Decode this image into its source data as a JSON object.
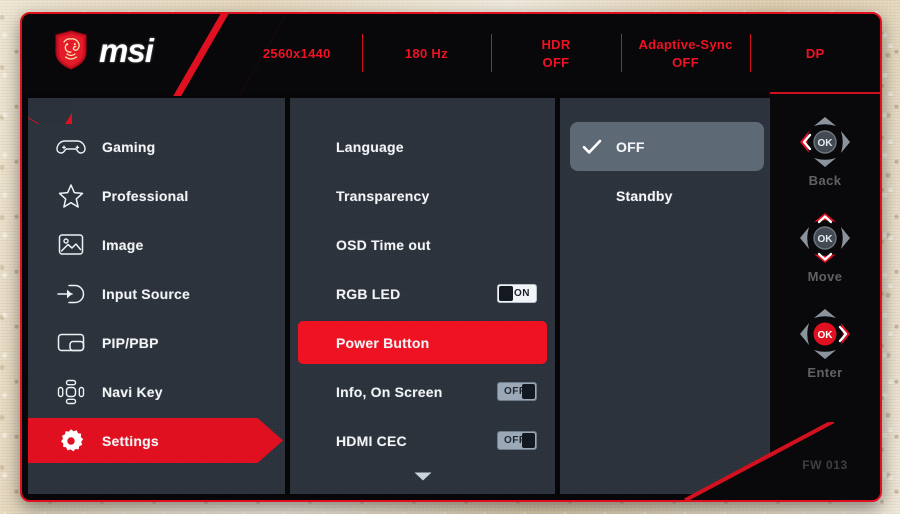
{
  "header": {
    "logo_icon": "msi-dragon-shield-icon",
    "brand": "msi",
    "info": [
      {
        "label": "2560x1440",
        "value": ""
      },
      {
        "label": "180 Hz",
        "value": ""
      },
      {
        "label": "HDR",
        "value": "OFF"
      },
      {
        "label": "Adaptive-Sync",
        "value": "OFF"
      },
      {
        "label": "DP",
        "value": ""
      }
    ]
  },
  "sidebar": {
    "items": [
      {
        "label": "Gaming",
        "icon": "gamepad-icon",
        "active": false
      },
      {
        "label": "Professional",
        "icon": "star-icon",
        "active": false
      },
      {
        "label": "Image",
        "icon": "picture-icon",
        "active": false
      },
      {
        "label": "Input Source",
        "icon": "input-arrow-icon",
        "active": false
      },
      {
        "label": "PIP/PBP",
        "icon": "pip-pbp-icon",
        "active": false
      },
      {
        "label": "Navi Key",
        "icon": "navi-key-icon",
        "active": false
      },
      {
        "label": "Settings",
        "icon": "gear-icon",
        "active": true
      }
    ]
  },
  "menu": {
    "items": [
      {
        "label": "Language",
        "toggle": null,
        "selected": false
      },
      {
        "label": "Transparency",
        "toggle": null,
        "selected": false
      },
      {
        "label": "OSD Time out",
        "toggle": null,
        "selected": false
      },
      {
        "label": "RGB LED",
        "toggle": "ON",
        "selected": false
      },
      {
        "label": "Power Button",
        "toggle": null,
        "selected": true
      },
      {
        "label": "Info, On Screen",
        "toggle": "OFF",
        "selected": false
      },
      {
        "label": "HDMI CEC",
        "toggle": "OFF",
        "selected": false
      }
    ],
    "scroll_down_icon": "chevron-down-icon"
  },
  "options": {
    "items": [
      {
        "label": "OFF",
        "selected": true,
        "check_icon": "checkmark-icon"
      },
      {
        "label": "Standby",
        "selected": false,
        "check_icon": ""
      }
    ]
  },
  "navigation": {
    "buttons": [
      {
        "label": "Back",
        "icon": "dpad-left-icon"
      },
      {
        "label": "Move",
        "icon": "dpad-updown-icon"
      },
      {
        "label": "Enter",
        "icon": "dpad-ok-icon"
      }
    ],
    "firmware": "FW 013"
  },
  "colors": {
    "accent_red": "#ee1222",
    "border_red": "#e01020",
    "panel_bg": "#2b323c",
    "osd_bg": "#070709",
    "selected_gray": "#5d6975"
  }
}
